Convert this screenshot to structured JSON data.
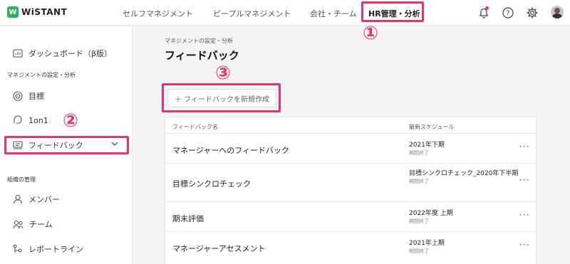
{
  "brand": {
    "logo_letter": "W",
    "name": "WiSTANT",
    "accent": "#2eb05a",
    "highlight": "#e8336d"
  },
  "topnav": {
    "items": [
      {
        "label": "セルフマネジメント"
      },
      {
        "label": "ピープルマネジメント"
      },
      {
        "label": "会社・チーム"
      },
      {
        "label": "HR管理・分析"
      }
    ],
    "icons": [
      "bell-icon",
      "help-icon",
      "gear-icon"
    ]
  },
  "sidebar": {
    "dashboard": "ダッシュボード（β版）",
    "section_mgmt": "マネジメントの設定・分析",
    "goal": "目標",
    "oneonone": "1on1",
    "feedback": "フィードバック",
    "section_org": "組織の管理",
    "member": "メンバー",
    "team": "チーム",
    "report_line": "レポートライン"
  },
  "annotations": {
    "n1": "①",
    "n2": "②",
    "n3": "③"
  },
  "main": {
    "breadcrumb": "マネジメントの設定・分析",
    "title": "フィードバック",
    "new_button": "＋ フィードバックを新規作成",
    "table": {
      "col_name": "フィードバック名",
      "col_schedule": "最新スケジュール",
      "rows": [
        {
          "name": "マネージャーへのフィードバック",
          "schedule": "2021年下期",
          "status": "期間終了"
        },
        {
          "name": "目標シンクロチェック",
          "schedule": "目標シンクロチェック_2020年下半期",
          "status": "期間終了"
        },
        {
          "name": "期末評価",
          "schedule": "2022年度 上期",
          "status": "期間終了"
        },
        {
          "name": "マネージャーアセスメント",
          "schedule": "2021年上期",
          "status": "期間終了"
        }
      ],
      "more_label": "···"
    }
  }
}
